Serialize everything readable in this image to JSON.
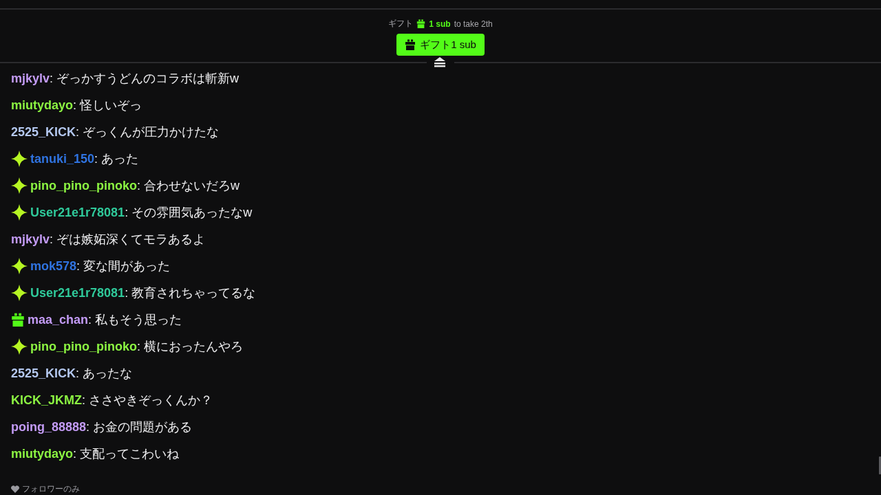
{
  "gift_goal": {
    "prefix": "ギフト",
    "amount": "1 sub",
    "suffix": "to take 2th"
  },
  "gift_button": {
    "label": "ギフト1 sub"
  },
  "messages": [
    {
      "kind": "plain",
      "user": "mjkylv",
      "color": "#c39bf5",
      "text": ": ぞっかすうどんのコラボは斬新w"
    },
    {
      "kind": "plain",
      "user": "miutydayo",
      "color": "#8cf542",
      "text": ": 怪しいぞっ"
    },
    {
      "kind": "plain",
      "user": "2525_KICK",
      "color": "#b4c8f0",
      "text": ": ぞっくんが圧力かけたな"
    },
    {
      "kind": "sparkle",
      "user": "tanuki_150",
      "color": "#2f73e0",
      "text": ": あった"
    },
    {
      "kind": "sparkle",
      "user": "pino_pino_pinoko",
      "color": "#8cf542",
      "text": ": 合わせないだろw"
    },
    {
      "kind": "sparkle",
      "user": "User21e1r78081",
      "color": "#2fc99a",
      "text": ": その雰囲気あったなw"
    },
    {
      "kind": "plain",
      "user": "mjkylv",
      "color": "#c39bf5",
      "text": ": ぞは嫉妬深くてモラあるよ"
    },
    {
      "kind": "sparkle",
      "user": "mok578",
      "color": "#2f73e0",
      "text": ": 変な間があった"
    },
    {
      "kind": "sparkle",
      "user": "User21e1r78081",
      "color": "#2fc99a",
      "text": ": 教育されちゃってるな"
    },
    {
      "kind": "gift",
      "user": "maa_chan",
      "color": "#c39bf5",
      "text": ": 私もそう思った"
    },
    {
      "kind": "sparkle",
      "user": "pino_pino_pinoko",
      "color": "#8cf542",
      "text": ": 横におったんやろ"
    },
    {
      "kind": "plain",
      "user": "2525_KICK",
      "color": "#b4c8f0",
      "text": ": あったな"
    },
    {
      "kind": "plain",
      "user": "KICK_JKMZ",
      "color": "#8cf542",
      "text": ": ささやきぞっくんか？"
    },
    {
      "kind": "plain",
      "user": "poing_88888",
      "color": "#c39bf5",
      "text": ": お金の問題がある"
    },
    {
      "kind": "plain",
      "user": "miutydayo",
      "color": "#8cf542",
      "text": ": 支配ってこわいね"
    }
  ],
  "footer": {
    "mode": "フォロワーのみ"
  }
}
